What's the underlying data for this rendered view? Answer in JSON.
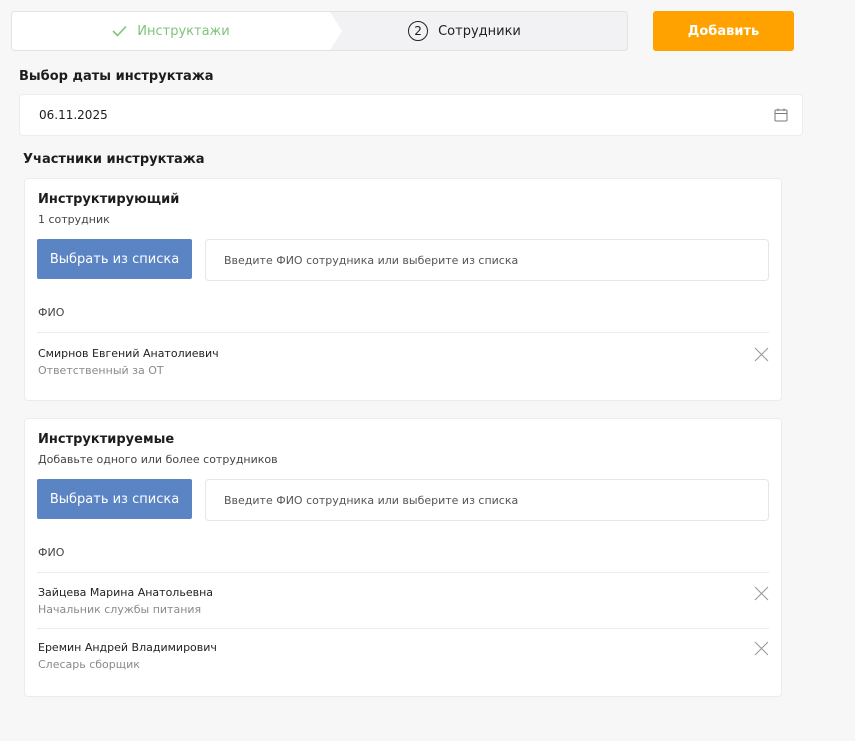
{
  "steps": {
    "done_label": "Инструктажи",
    "active_number": "2",
    "active_label": "Сотрудники"
  },
  "add_button": "Добавить",
  "date_section": {
    "title": "Выбор даты инструктажа",
    "value": "06.11.2025"
  },
  "participants_title": "Участники инструктажа",
  "instructor": {
    "title": "Инструктирующий",
    "subtitle": "1 сотрудник",
    "pick_button": "Выбрать из списка",
    "search_placeholder": "Введите ФИО сотрудника или выберите из списка",
    "column_header": "ФИО",
    "people": [
      {
        "name": "Смирнов Евгений Анатолиевич",
        "role": "Ответственный за ОТ"
      }
    ]
  },
  "trainees": {
    "title": "Инструктируемые",
    "subtitle": "Добавьте одного или более сотрудников",
    "pick_button": "Выбрать из списка",
    "search_placeholder": "Введите ФИО сотрудника или выберите из списка",
    "column_header": "ФИО",
    "people": [
      {
        "name": "Зайцева Марина Анатольевна",
        "role": "Начальник службы питания"
      },
      {
        "name": "Еремин Андрей Владимирович",
        "role": "Слесарь сборщик"
      }
    ]
  },
  "colors": {
    "accent_orange": "#ffa200",
    "button_blue": "#5b84c4",
    "done_green": "#7ec47a"
  }
}
